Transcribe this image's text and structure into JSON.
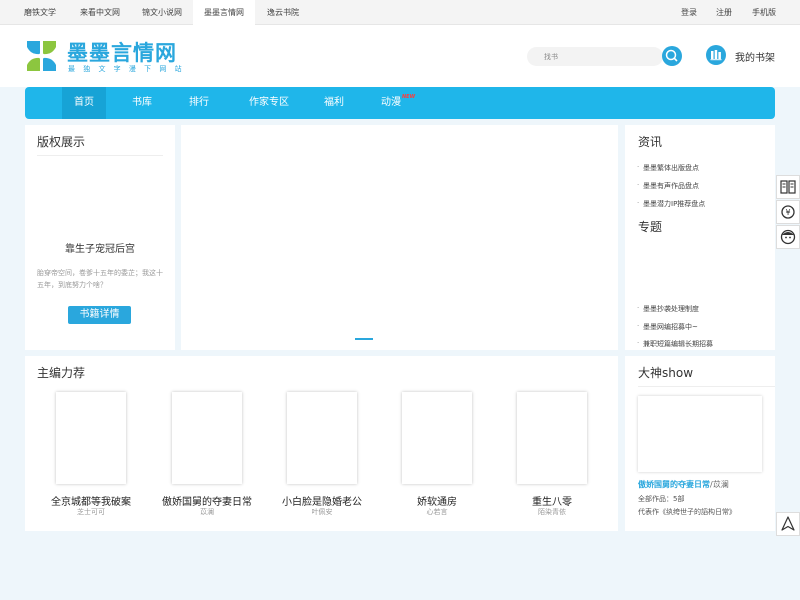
{
  "topbar": {
    "sites": [
      "磨铁文学",
      "来看中文网",
      "锦文小说网",
      "墨墨言情网",
      "逸云书院"
    ],
    "active_site": 3,
    "login": "登录",
    "register": "注册",
    "mobile": "手机版"
  },
  "header": {
    "logo_title": "墨墨言情网",
    "logo_sub": "最 独 文 字 漫 下 网 站",
    "search_placeholder": "找书",
    "shelf_label": "我的书架"
  },
  "nav": {
    "items": [
      "首页",
      "书库",
      "排行",
      "作家专区",
      "福利",
      "动漫"
    ],
    "active": 0,
    "new_badge": "NEW"
  },
  "copyright": {
    "title": "版权展示",
    "book_title": "靠生子宠冠后宫",
    "desc": "胎穿帝空间，卷爹十五年的委芷；我这十五年，到底努力个啥？",
    "button": "书籍详情"
  },
  "news": {
    "title": "资讯",
    "items": [
      "墨墨繁体出版盘点",
      "墨墨有声作品盘点",
      "墨墨潜力IP推荐盘点"
    ]
  },
  "topics": {
    "title": "专题",
    "items": [
      "墨墨抄袭处理制度",
      "墨墨网编招募中~",
      "兼职短篇编辑长期招募"
    ]
  },
  "picks": {
    "title": "主编力荐",
    "books": [
      {
        "name": "全京城都等我破案",
        "author": "芝士可可"
      },
      {
        "name": "傲娇国舅的夺妻日常",
        "author": "苡澜"
      },
      {
        "name": "小白脸是隐婚老公",
        "author": "叶佩安"
      },
      {
        "name": "娇软通房",
        "author": "心若言"
      },
      {
        "name": "重生八零",
        "author": "陌染青依"
      }
    ]
  },
  "god": {
    "title": "大神show",
    "book": "傲娇国舅的夺妻日常",
    "author": "/苡澜",
    "works": "全部作品：5部",
    "rep": "代表作《纨绔世子的謟构日常》"
  },
  "icons": {
    "logo": "butterfly-logo-icon",
    "search": "search-icon",
    "shelf": "bookshelf-icon",
    "tools": [
      "book-icon",
      "yen-coin-icon",
      "face-icon",
      "up-arrow-icon"
    ]
  },
  "colors": {
    "accent": "#2aa7dd",
    "nav": "#1fb6ea",
    "logo_green": "#8cc63f"
  }
}
